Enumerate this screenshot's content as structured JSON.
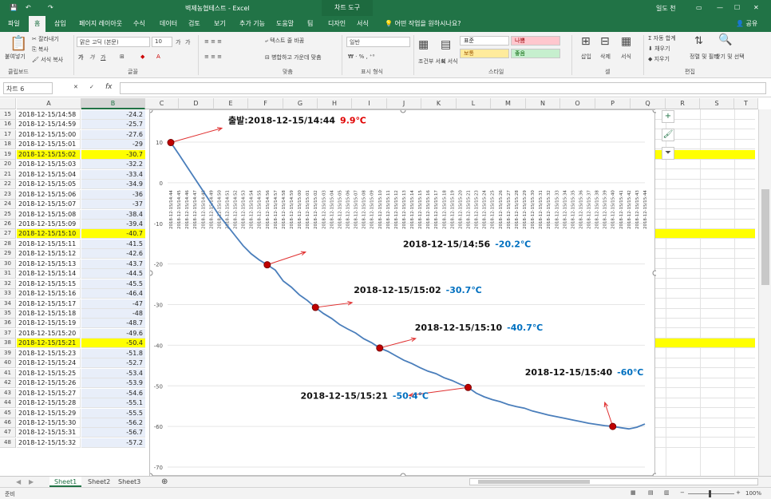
{
  "window": {
    "title": "벽제농협테스트 - Excel",
    "context_tab": "차트 도구",
    "user": "일도 천"
  },
  "quick_access": {
    "save": "💾",
    "undo": "↶",
    "redo": "↷"
  },
  "ribbon_tabs": [
    "파일",
    "홈",
    "삽입",
    "페이지 레이아웃",
    "수식",
    "데이터",
    "검토",
    "보기",
    "추가 기능",
    "도움말",
    "팀",
    "디자인",
    "서식"
  ],
  "tell_me": "어떤 작업을 원하시나요?",
  "share": "공유",
  "ribbon": {
    "clipboard": {
      "paste": "붙여넣기",
      "cut": "잘라내기",
      "copy": "복사",
      "format_painter": "서식 복사",
      "label": "클립보드"
    },
    "font": {
      "name": "맑은 고딕 (본문)",
      "size": "10",
      "grow": "가",
      "shrink": "가",
      "bold": "가",
      "italic": "가",
      "underline": "가",
      "label": "글꼴"
    },
    "align": {
      "wrap": "텍스트 줄 바꿈",
      "merge": "병합하고 가운데 맞춤",
      "label": "맞춤"
    },
    "number": {
      "format": "일반",
      "label": "표시 형식"
    },
    "styles": {
      "cond": "조건부 서식",
      "table": "표 서식",
      "normal": "표준",
      "bad": "나쁨",
      "good": "보통",
      "neutral": "좋음",
      "label": "스타일"
    },
    "cells": {
      "insert": "삽입",
      "delete": "삭제",
      "format": "서식",
      "label": "셀"
    },
    "edit": {
      "autosum": "자동 합계",
      "fill": "채우기",
      "clear": "지우기",
      "sort": "정렬 및 필터",
      "find": "찾기 및 선택",
      "label": "편집"
    }
  },
  "name_box": "차트 6",
  "fx": "fx",
  "columns": [
    "A",
    "B",
    "C",
    "D",
    "E",
    "F",
    "G",
    "H",
    "I",
    "J",
    "K",
    "L",
    "M",
    "N",
    "O",
    "P",
    "Q",
    "R",
    "S",
    "T"
  ],
  "rows": [
    {
      "n": "15",
      "a": "2018-12-15/14:58",
      "b": "-24.2",
      "hl": false
    },
    {
      "n": "16",
      "a": "2018-12-15/14:59",
      "b": "-25.7",
      "hl": false
    },
    {
      "n": "17",
      "a": "2018-12-15/15:00",
      "b": "-27.6",
      "hl": false
    },
    {
      "n": "18",
      "a": "2018-12-15/15:01",
      "b": "-29",
      "hl": false
    },
    {
      "n": "19",
      "a": "2018-12-15/15:02",
      "b": "-30.7",
      "hl": true
    },
    {
      "n": "20",
      "a": "2018-12-15/15:03",
      "b": "-32.2",
      "hl": false
    },
    {
      "n": "21",
      "a": "2018-12-15/15:04",
      "b": "-33.4",
      "hl": false
    },
    {
      "n": "22",
      "a": "2018-12-15/15:05",
      "b": "-34.9",
      "hl": false
    },
    {
      "n": "23",
      "a": "2018-12-15/15:06",
      "b": "-36",
      "hl": false
    },
    {
      "n": "24",
      "a": "2018-12-15/15:07",
      "b": "-37",
      "hl": false
    },
    {
      "n": "25",
      "a": "2018-12-15/15:08",
      "b": "-38.4",
      "hl": false
    },
    {
      "n": "26",
      "a": "2018-12-15/15:09",
      "b": "-39.4",
      "hl": false
    },
    {
      "n": "27",
      "a": "2018-12-15/15:10",
      "b": "-40.7",
      "hl": true
    },
    {
      "n": "28",
      "a": "2018-12-15/15:11",
      "b": "-41.5",
      "hl": false
    },
    {
      "n": "29",
      "a": "2018-12-15/15:12",
      "b": "-42.6",
      "hl": false
    },
    {
      "n": "30",
      "a": "2018-12-15/15:13",
      "b": "-43.7",
      "hl": false
    },
    {
      "n": "31",
      "a": "2018-12-15/15:14",
      "b": "-44.5",
      "hl": false
    },
    {
      "n": "32",
      "a": "2018-12-15/15:15",
      "b": "-45.5",
      "hl": false
    },
    {
      "n": "33",
      "a": "2018-12-15/15:16",
      "b": "-46.4",
      "hl": false
    },
    {
      "n": "34",
      "a": "2018-12-15/15:17",
      "b": "-47",
      "hl": false
    },
    {
      "n": "35",
      "a": "2018-12-15/15:18",
      "b": "-48",
      "hl": false
    },
    {
      "n": "36",
      "a": "2018-12-15/15:19",
      "b": "-48.7",
      "hl": false
    },
    {
      "n": "37",
      "a": "2018-12-15/15:20",
      "b": "-49.6",
      "hl": false
    },
    {
      "n": "38",
      "a": "2018-12-15/15:21",
      "b": "-50.4",
      "hl": true
    },
    {
      "n": "39",
      "a": "2018-12-15/15:23",
      "b": "-51.8",
      "hl": false
    },
    {
      "n": "40",
      "a": "2018-12-15/15:24",
      "b": "-52.7",
      "hl": false
    },
    {
      "n": "41",
      "a": "2018-12-15/15:25",
      "b": "-53.4",
      "hl": false
    },
    {
      "n": "42",
      "a": "2018-12-15/15:26",
      "b": "-53.9",
      "hl": false
    },
    {
      "n": "43",
      "a": "2018-12-15/15:27",
      "b": "-54.6",
      "hl": false
    },
    {
      "n": "44",
      "a": "2018-12-15/15:28",
      "b": "-55.1",
      "hl": false
    },
    {
      "n": "45",
      "a": "2018-12-15/15:29",
      "b": "-55.5",
      "hl": false
    },
    {
      "n": "46",
      "a": "2018-12-15/15:30",
      "b": "-56.2",
      "hl": false
    },
    {
      "n": "47",
      "a": "2018-12-15/15:31",
      "b": "-56.7",
      "hl": false
    },
    {
      "n": "48",
      "a": "2018-12-15/15:32",
      "b": "-57.2",
      "hl": false
    }
  ],
  "chart_data": {
    "type": "line",
    "x": [
      "2018-12-15/14:44",
      "2018-12-15/14:45",
      "2018-12-15/14:46",
      "2018-12-15/14:47",
      "2018-12-15/14:48",
      "2018-12-15/14:49",
      "2018-12-15/14:50",
      "2018-12-15/14:51",
      "2018-12-15/14:52",
      "2018-12-15/14:53",
      "2018-12-15/14:54",
      "2018-12-15/14:55",
      "2018-12-15/14:56",
      "2018-12-15/14:57",
      "2018-12-15/14:58",
      "2018-12-15/14:59",
      "2018-12-15/15:00",
      "2018-12-15/15:01",
      "2018-12-15/15:02",
      "2018-12-15/15:03",
      "2018-12-15/15:04",
      "2018-12-15/15:05",
      "2018-12-15/15:06",
      "2018-12-15/15:07",
      "2018-12-15/15:08",
      "2018-12-15/15:09",
      "2018-12-15/15:10",
      "2018-12-15/15:11",
      "2018-12-15/15:12",
      "2018-12-15/15:13",
      "2018-12-15/15:14",
      "2018-12-15/15:15",
      "2018-12-15/15:16",
      "2018-12-15/15:17",
      "2018-12-15/15:18",
      "2018-12-15/15:19",
      "2018-12-15/15:20",
      "2018-12-15/15:21",
      "2018-12-15/15:23",
      "2018-12-15/15:24",
      "2018-12-15/15:25",
      "2018-12-15/15:26",
      "2018-12-15/15:27",
      "2018-12-15/15:28",
      "2018-12-15/15:29",
      "2018-12-15/15:30",
      "2018-12-15/15:31",
      "2018-12-15/15:32",
      "2018-12-15/15:33",
      "2018-12-15/15:34",
      "2018-12-15/15:35",
      "2018-12-15/15:36",
      "2018-12-15/15:37",
      "2018-12-15/15:38",
      "2018-12-15/15:39",
      "2018-12-15/15:40",
      "2018-12-15/15:41",
      "2018-12-15/15:42",
      "2018-12-15/15:43",
      "2018-12-15/15:44"
    ],
    "values": [
      9.9,
      7,
      4,
      1,
      -2,
      -5,
      -8,
      -10.5,
      -13,
      -15.5,
      -17.5,
      -19,
      -20.2,
      -21.5,
      -24.2,
      -25.7,
      -27.6,
      -29,
      -30.7,
      -32.2,
      -33.4,
      -34.9,
      -36,
      -37,
      -38.4,
      -39.4,
      -40.7,
      -41.5,
      -42.6,
      -43.7,
      -44.5,
      -45.5,
      -46.4,
      -47,
      -48,
      -48.7,
      -49.6,
      -50.4,
      -51.8,
      -52.7,
      -53.4,
      -53.9,
      -54.6,
      -55.1,
      -55.5,
      -56.2,
      -56.7,
      -57.2,
      -57.6,
      -58,
      -58.4,
      -58.8,
      -59.2,
      -59.5,
      -59.8,
      -60,
      -60.3,
      -60.6,
      -60.2,
      -59.4
    ],
    "ylim": [
      -70,
      10
    ],
    "yticks": [
      "10",
      "0",
      "-10",
      "-20",
      "-30",
      "-40",
      "-50",
      "-60",
      "-70"
    ],
    "line_color": "#4a7ebb",
    "marker_color": "#c00000",
    "annotations": [
      {
        "label": "출발:2018-12-15/14:44",
        "value": "9.9℃",
        "color": "#e00000",
        "idx": 0
      },
      {
        "label": "2018-12-15/14:56",
        "value": "-20.2℃",
        "color": "#0070c0",
        "idx": 12
      },
      {
        "label": "2018-12-15/15:02",
        "value": "-30.7℃",
        "color": "#0070c0",
        "idx": 18
      },
      {
        "label": "2018-12-15/15:10",
        "value": "-40.7℃",
        "color": "#0070c0",
        "idx": 26
      },
      {
        "label": "2018-12-15/15:21",
        "value": "-50.4℃",
        "color": "#0070c0",
        "idx": 37
      },
      {
        "label": "2018-12-15/15:40",
        "value": "-60℃",
        "color": "#0070c0",
        "idx": 55
      }
    ]
  },
  "sheets": [
    "Sheet1",
    "Sheet2",
    "Sheet3"
  ],
  "status": {
    "ready": "준비",
    "zoom": "100%"
  }
}
